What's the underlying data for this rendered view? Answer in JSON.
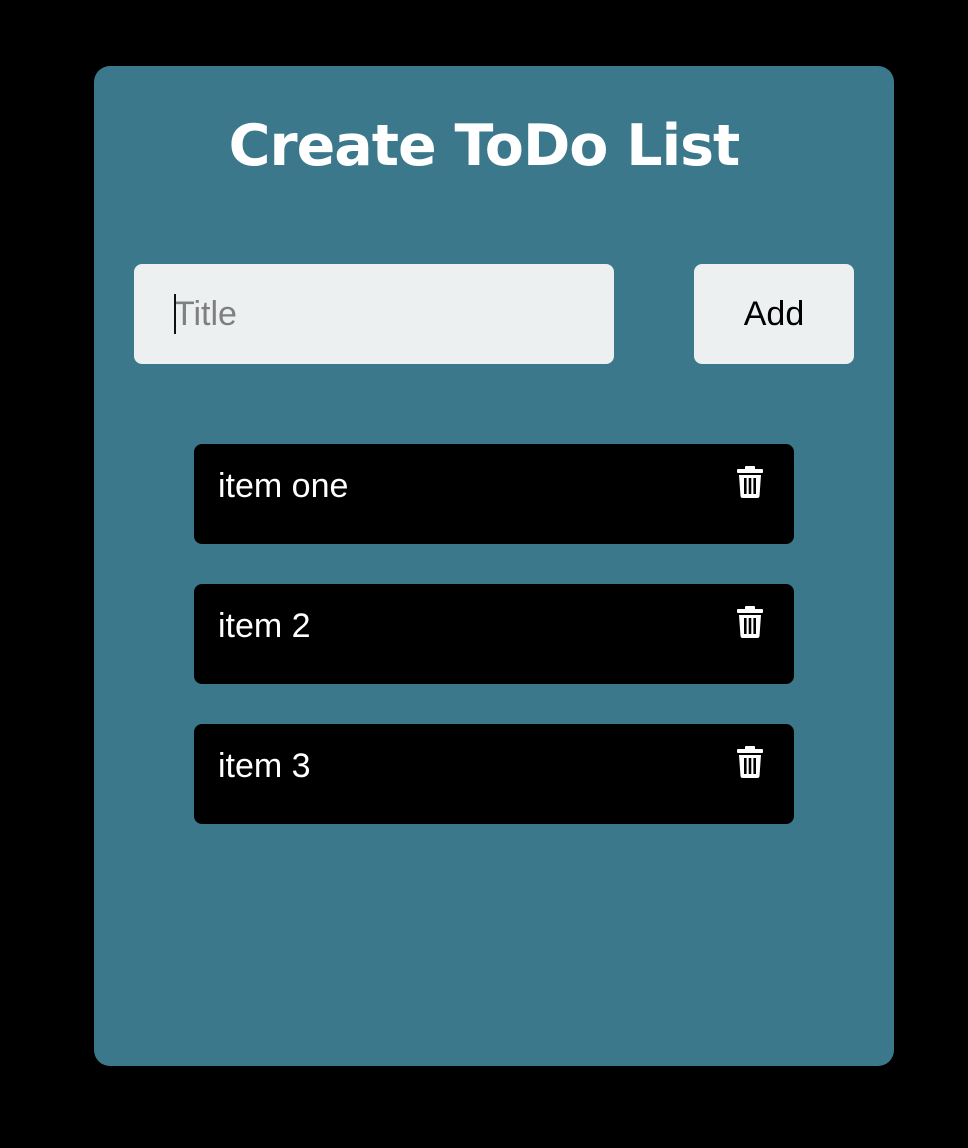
{
  "app": {
    "heading": "Create ToDo List"
  },
  "form": {
    "input_value": "",
    "input_placeholder": "Title",
    "add_label": "Add"
  },
  "todos": [
    {
      "label": "item one",
      "icon": "trash-icon"
    },
    {
      "label": "item 2",
      "icon": "trash-icon"
    },
    {
      "label": "item 3",
      "icon": "trash-icon"
    }
  ],
  "colors": {
    "background": "#000000",
    "card": "#3b788b",
    "input": "#ecf0f1",
    "item": "#000000",
    "text_light": "#ffffff"
  }
}
